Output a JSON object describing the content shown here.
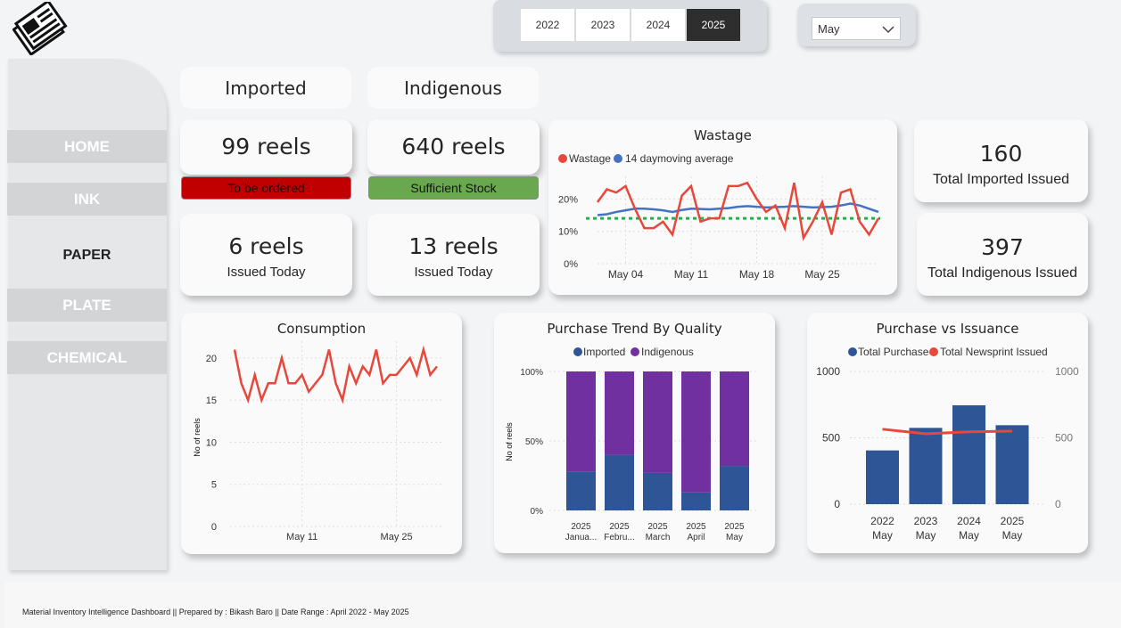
{
  "filters": {
    "years": [
      "2022",
      "2023",
      "2024",
      "2025"
    ],
    "selected_year": "2025",
    "month": "May"
  },
  "nav": [
    "HOME",
    "INK",
    "PAPER",
    "PLATE",
    "CHEMICAL"
  ],
  "nav_active": "PAPER",
  "headers": {
    "imported": "Imported",
    "indigenous": "Indigenous"
  },
  "kpis": {
    "imported_stock": "99 reels",
    "imported_status": "To be ordered",
    "indigenous_stock": "640 reels",
    "indigenous_status": "Sufficient Stock",
    "imported_today": "6 reels",
    "imported_today_label": "Issued Today",
    "indigenous_today": "13 reels",
    "indigenous_today_label": "Issued Today",
    "total_imported": "160",
    "total_imported_label": "Total Imported Issued",
    "total_indigenous": "397",
    "total_indigenous_label": "Total Indigenous Issued"
  },
  "colors": {
    "red_badge": "#c00000",
    "green_badge": "#6aa84f",
    "red_line": "#e8473b",
    "blue_line": "#4472c4",
    "navy_bar": "#2e5596",
    "purple_bar": "#7030a0",
    "target_line": "#22b14c"
  },
  "chart_data": [
    {
      "type": "line",
      "title": "Wastage",
      "series": [
        {
          "name": "Wastage",
          "values": [
            19,
            23,
            22,
            24,
            17,
            11,
            11,
            13,
            9,
            21,
            24,
            13,
            14,
            14,
            24,
            24,
            25,
            20,
            16,
            18,
            11,
            25,
            8,
            13,
            19,
            9,
            22,
            23,
            13,
            9,
            14
          ]
        },
        {
          "name": "14 daymoving average",
          "values": [
            15,
            15.3,
            16,
            16.5,
            17,
            17,
            16.8,
            16.5,
            16,
            16.6,
            17,
            16.9,
            16.8,
            17,
            17.2,
            17.6,
            17.8,
            17.6,
            17.4,
            17.5,
            17.6,
            17.8,
            17.6,
            17.4,
            17.5,
            17.6,
            18,
            18.6,
            18,
            17,
            16
          ]
        }
      ],
      "target": 14,
      "xticks": [
        "May 04",
        "May 11",
        "May 18",
        "May 25"
      ],
      "yticks": [
        "0%",
        "10%",
        "20%"
      ],
      "ylim": [
        0,
        27
      ]
    },
    {
      "type": "line",
      "title": "Consumption",
      "ylabel": "No of reels",
      "series": [
        {
          "name": "Consumption",
          "values": [
            21,
            17,
            15,
            18,
            15,
            17,
            17,
            20,
            17,
            17,
            18,
            16,
            17,
            18,
            21,
            17,
            15,
            19,
            17,
            19,
            18,
            21,
            17,
            18,
            18,
            19,
            20,
            18,
            21,
            18,
            19
          ]
        }
      ],
      "xticks": [
        "May 11",
        "May 25"
      ],
      "yticks": [
        "0",
        "5",
        "10",
        "15",
        "20"
      ],
      "ylim": [
        0,
        22
      ]
    },
    {
      "type": "bar",
      "title": "Purchase Trend By Quality",
      "ylabel": "No of reels",
      "categories": [
        [
          "2025",
          "Janua..."
        ],
        [
          "2025",
          "Febru..."
        ],
        [
          "2025",
          "March"
        ],
        [
          "2025",
          "April"
        ],
        [
          "2025",
          "May"
        ]
      ],
      "series": [
        {
          "name": "Imported",
          "values": [
            28,
            40,
            27,
            13,
            32
          ]
        },
        {
          "name": "Indigenous",
          "values": [
            72,
            60,
            73,
            87,
            68
          ]
        }
      ],
      "yticks": [
        "0%",
        "50%",
        "100%"
      ],
      "ylim": [
        0,
        100
      ]
    },
    {
      "type": "bar",
      "title": "Purchase vs Issuance",
      "categories": [
        [
          "2022",
          "May"
        ],
        [
          "2023",
          "May"
        ],
        [
          "2024",
          "May"
        ],
        [
          "2025",
          "May"
        ]
      ],
      "series": [
        {
          "name": "Total Purchase",
          "values": [
            405,
            575,
            745,
            595
          ]
        },
        {
          "name": "Total Newsprint Issued",
          "values": [
            565,
            530,
            545,
            550
          ]
        }
      ],
      "yticks": [
        "0",
        "500",
        "1000"
      ],
      "ylim": [
        0,
        1000
      ]
    }
  ],
  "footer": "Material Inventory Intelligence Dashboard || Prepared by : Bikash Baro || Date Range : April 2022 - May 2025"
}
